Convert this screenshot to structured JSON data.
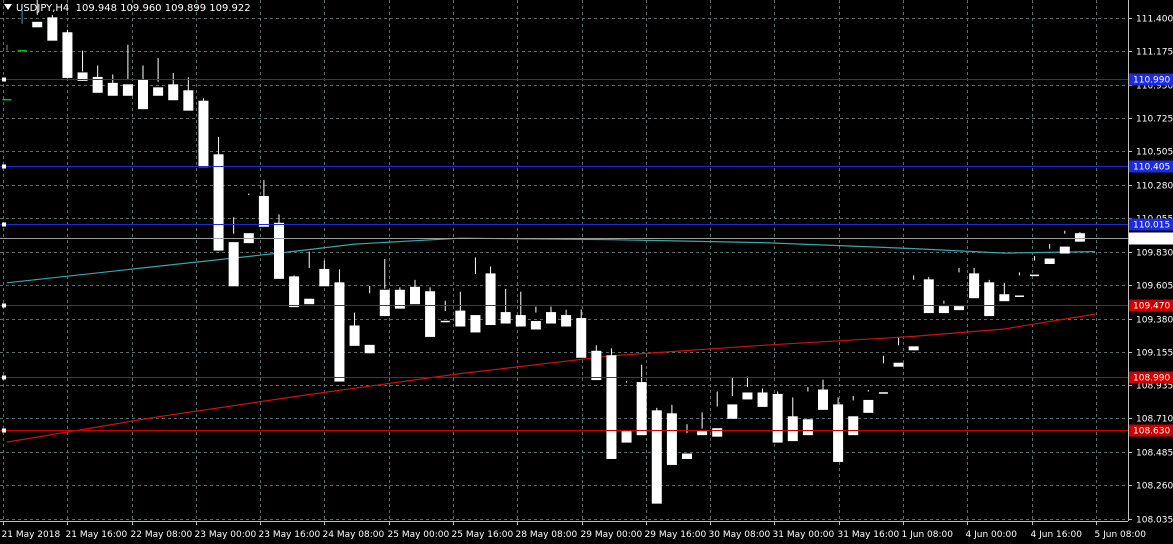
{
  "header": {
    "symbol": "USDJPY,H4",
    "ohlc": "109.948 109.960 109.899 109.922"
  },
  "colors": {
    "background": "#000000",
    "grid": "#5a6b6b",
    "frame": "#c0c0c0",
    "bull_candle": "#000000",
    "bear_candle": "#ffffff",
    "wick": "#ffffff",
    "doji_green": "#00c000",
    "ma_fast": "#3aa6a6",
    "ma_slow": "#d01010",
    "resistance_lines": "#1e2bd8",
    "support_lines": "#cc0000",
    "price_label_bg": "#ffffff",
    "price_label_text": "#000000"
  },
  "chart_data": {
    "type": "candlestick",
    "symbol": "USDJPY",
    "timeframe": "H4",
    "ylim": [
      108.02,
      111.52
    ],
    "y_ticks": [
      "111.400",
      "111.175",
      "110.950",
      "110.725",
      "110.505",
      "110.280",
      "110.055",
      "109.830",
      "109.605",
      "109.380",
      "109.155",
      "108.935",
      "108.710",
      "108.485",
      "108.260",
      "108.035"
    ],
    "x_ticks": [
      "21 May 2018",
      "21 May 16:00",
      "22 May 08:00",
      "23 May 00:00",
      "23 May 16:00",
      "24 May 08:00",
      "25 May 00:00",
      "25 May 16:00",
      "28 May 08:00",
      "29 May 00:00",
      "29 May 16:00",
      "30 May 08:00",
      "31 May 00:00",
      "31 May 16:00",
      "1 Jun 08:00",
      "4 Jun 00:00",
      "4 Jun 16:00",
      "5 Jun 08:00"
    ],
    "current_price": 109.922,
    "current_price_label": "109.922",
    "horizontal_lines": [
      {
        "value": 110.99,
        "color": "blue",
        "label": "110.990"
      },
      {
        "value": 110.405,
        "color": "blue",
        "label": "110.405"
      },
      {
        "value": 110.015,
        "color": "blue",
        "label": "110.015"
      },
      {
        "value": 109.47,
        "color": "red",
        "label": "109.470"
      },
      {
        "value": 108.99,
        "color": "red",
        "label": "108.990"
      },
      {
        "value": 108.63,
        "color": "red",
        "label": "108.630"
      }
    ],
    "candles": [
      [
        110.85,
        111.22,
        111.18,
        110.85
      ],
      [
        111.18,
        111.45,
        111.36,
        111.18
      ],
      [
        111.37,
        111.52,
        111.42,
        111.34
      ],
      [
        111.4,
        111.42,
        111.3,
        111.25
      ],
      [
        111.3,
        111.32,
        111.03,
        111.0
      ],
      [
        111.03,
        111.18,
        111.04,
        110.98
      ],
      [
        111.0,
        111.08,
        110.96,
        110.9
      ],
      [
        110.96,
        111.02,
        110.94,
        110.88
      ],
      [
        110.95,
        111.22,
        110.99,
        110.88
      ],
      [
        110.98,
        111.08,
        110.91,
        110.79
      ],
      [
        110.93,
        111.13,
        110.97,
        110.88
      ],
      [
        110.95,
        111.03,
        110.89,
        110.85
      ],
      [
        110.91,
        111.0,
        110.85,
        110.78
      ],
      [
        110.84,
        110.86,
        110.47,
        110.4
      ],
      [
        110.48,
        110.6,
        109.88,
        109.84
      ],
      [
        109.89,
        110.06,
        109.95,
        109.6
      ],
      [
        109.95,
        110.22,
        110.21,
        109.89
      ],
      [
        110.2,
        110.31,
        110.03,
        110.0
      ],
      [
        110.02,
        110.08,
        109.66,
        109.65
      ],
      [
        109.66,
        109.67,
        109.49,
        109.46
      ],
      [
        109.51,
        109.83,
        109.72,
        109.48
      ],
      [
        109.71,
        109.77,
        109.62,
        109.6
      ],
      [
        109.62,
        109.71,
        109.34,
        108.96
      ],
      [
        109.33,
        109.42,
        109.25,
        109.2
      ],
      [
        109.2,
        109.6,
        109.55,
        109.15
      ],
      [
        109.57,
        109.78,
        109.58,
        109.4
      ],
      [
        109.57,
        109.59,
        109.57,
        109.45
      ],
      [
        109.59,
        109.64,
        109.58,
        109.48
      ],
      [
        109.56,
        109.59,
        109.36,
        109.26
      ],
      [
        109.36,
        109.5,
        109.43,
        109.35
      ],
      [
        109.43,
        109.56,
        109.37,
        109.33
      ],
      [
        109.4,
        109.79,
        109.68,
        109.29
      ],
      [
        109.68,
        109.73,
        109.45,
        109.34
      ],
      [
        109.42,
        109.58,
        109.39,
        109.35
      ],
      [
        109.4,
        109.56,
        109.37,
        109.33
      ],
      [
        109.36,
        109.46,
        109.42,
        109.31
      ],
      [
        109.42,
        109.46,
        109.4,
        109.35
      ],
      [
        109.4,
        109.44,
        109.38,
        109.33
      ],
      [
        109.38,
        109.44,
        109.17,
        109.12
      ],
      [
        109.16,
        109.2,
        109.13,
        108.97
      ],
      [
        109.13,
        109.18,
        108.6,
        108.44
      ],
      [
        108.62,
        108.96,
        108.95,
        108.55
      ],
      [
        108.95,
        109.07,
        108.75,
        108.6
      ],
      [
        108.76,
        108.78,
        108.76,
        108.14
      ],
      [
        108.74,
        108.8,
        108.46,
        108.4
      ],
      [
        108.47,
        108.67,
        108.61,
        108.44
      ],
      [
        108.62,
        108.75,
        108.64,
        108.6
      ],
      [
        108.64,
        108.89,
        108.79,
        108.59
      ],
      [
        108.8,
        108.98,
        108.86,
        108.71
      ],
      [
        108.88,
        108.99,
        108.92,
        108.84
      ],
      [
        108.88,
        108.91,
        108.87,
        108.79
      ],
      [
        108.87,
        108.89,
        108.72,
        108.55
      ],
      [
        108.72,
        108.85,
        108.71,
        108.56
      ],
      [
        108.7,
        108.92,
        108.89,
        108.6
      ],
      [
        108.9,
        108.97,
        108.79,
        108.77
      ],
      [
        108.8,
        108.85,
        108.74,
        108.42
      ],
      [
        108.72,
        108.86,
        108.83,
        108.6
      ],
      [
        108.83,
        108.9,
        108.89,
        108.75
      ],
      [
        108.88,
        109.13,
        109.08,
        108.87
      ],
      [
        109.08,
        109.25,
        109.2,
        109.06
      ],
      [
        109.19,
        109.67,
        109.64,
        109.17
      ],
      [
        109.64,
        109.66,
        109.45,
        109.42
      ],
      [
        109.46,
        109.48,
        109.5,
        109.42
      ],
      [
        109.46,
        109.72,
        109.69,
        109.44
      ],
      [
        109.68,
        109.72,
        109.63,
        109.52
      ],
      [
        109.62,
        109.64,
        109.54,
        109.4
      ],
      [
        109.54,
        109.62,
        109.53,
        109.5
      ],
      [
        109.53,
        109.69,
        109.67,
        109.52
      ],
      [
        109.67,
        109.8,
        109.77,
        109.66
      ],
      [
        109.78,
        109.88,
        109.85,
        109.75
      ],
      [
        109.86,
        109.97,
        109.95,
        109.82
      ],
      [
        109.95,
        109.96,
        109.92,
        109.9
      ]
    ],
    "ma_fast": [
      [
        0,
        109.62
      ],
      [
        9,
        109.72
      ],
      [
        18,
        109.82
      ],
      [
        23,
        109.88
      ],
      [
        30,
        109.92
      ],
      [
        40,
        109.91
      ],
      [
        50,
        109.89
      ],
      [
        60,
        109.85
      ],
      [
        66,
        109.82
      ],
      [
        72,
        109.83
      ]
    ],
    "ma_slow": [
      [
        0,
        108.55
      ],
      [
        10,
        108.72
      ],
      [
        20,
        108.87
      ],
      [
        30,
        109.01
      ],
      [
        40,
        109.13
      ],
      [
        50,
        109.2
      ],
      [
        60,
        109.26
      ],
      [
        66,
        109.31
      ],
      [
        72,
        109.41
      ]
    ]
  }
}
